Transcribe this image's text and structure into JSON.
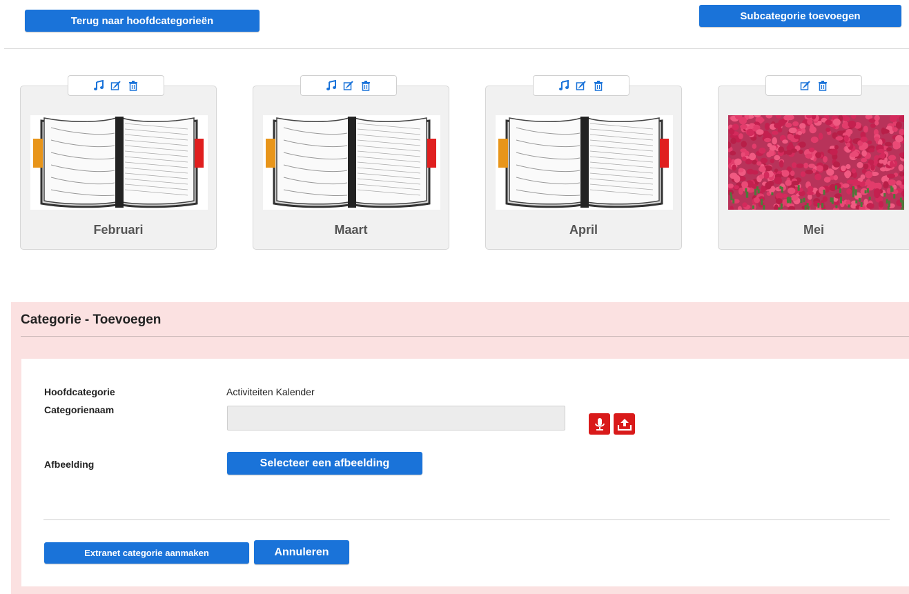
{
  "header": {
    "back_label": "Terug naar hoofdcategorieën",
    "add_subcategory_label": "Subcategorie toevoegen"
  },
  "categories": [
    {
      "label": "Februari",
      "image": "agenda-book",
      "icons": [
        "music-note-icon",
        "edit-icon",
        "trash-icon"
      ]
    },
    {
      "label": "Maart",
      "image": "agenda-book",
      "icons": [
        "music-note-icon",
        "edit-icon",
        "trash-icon"
      ]
    },
    {
      "label": "April",
      "image": "agenda-book",
      "icons": [
        "music-note-icon",
        "edit-icon",
        "trash-icon"
      ]
    },
    {
      "label": "Mei",
      "image": "tulip-field",
      "icons": [
        "edit-icon",
        "trash-icon"
      ]
    }
  ],
  "form": {
    "title": "Categorie - Toevoegen",
    "parent_label": "Hoofdcategorie",
    "parent_value": "Activiteiten Kalender",
    "name_label": "Categorienaam",
    "name_value": "",
    "image_label": "Afbeelding",
    "select_image_label": "Selecteer een afbeelding",
    "create_label": "Extranet categorie aanmaken",
    "cancel_label": "Annuleren",
    "mic_icon": "microphone-icon",
    "upload_icon": "upload-icon"
  },
  "colors": {
    "primary_button": "#1a73d9",
    "danger_button": "#d91a1a",
    "panel_background": "#fbe1e1",
    "card_background": "#f1f1f1",
    "icon_blue": "#1a73d9"
  }
}
